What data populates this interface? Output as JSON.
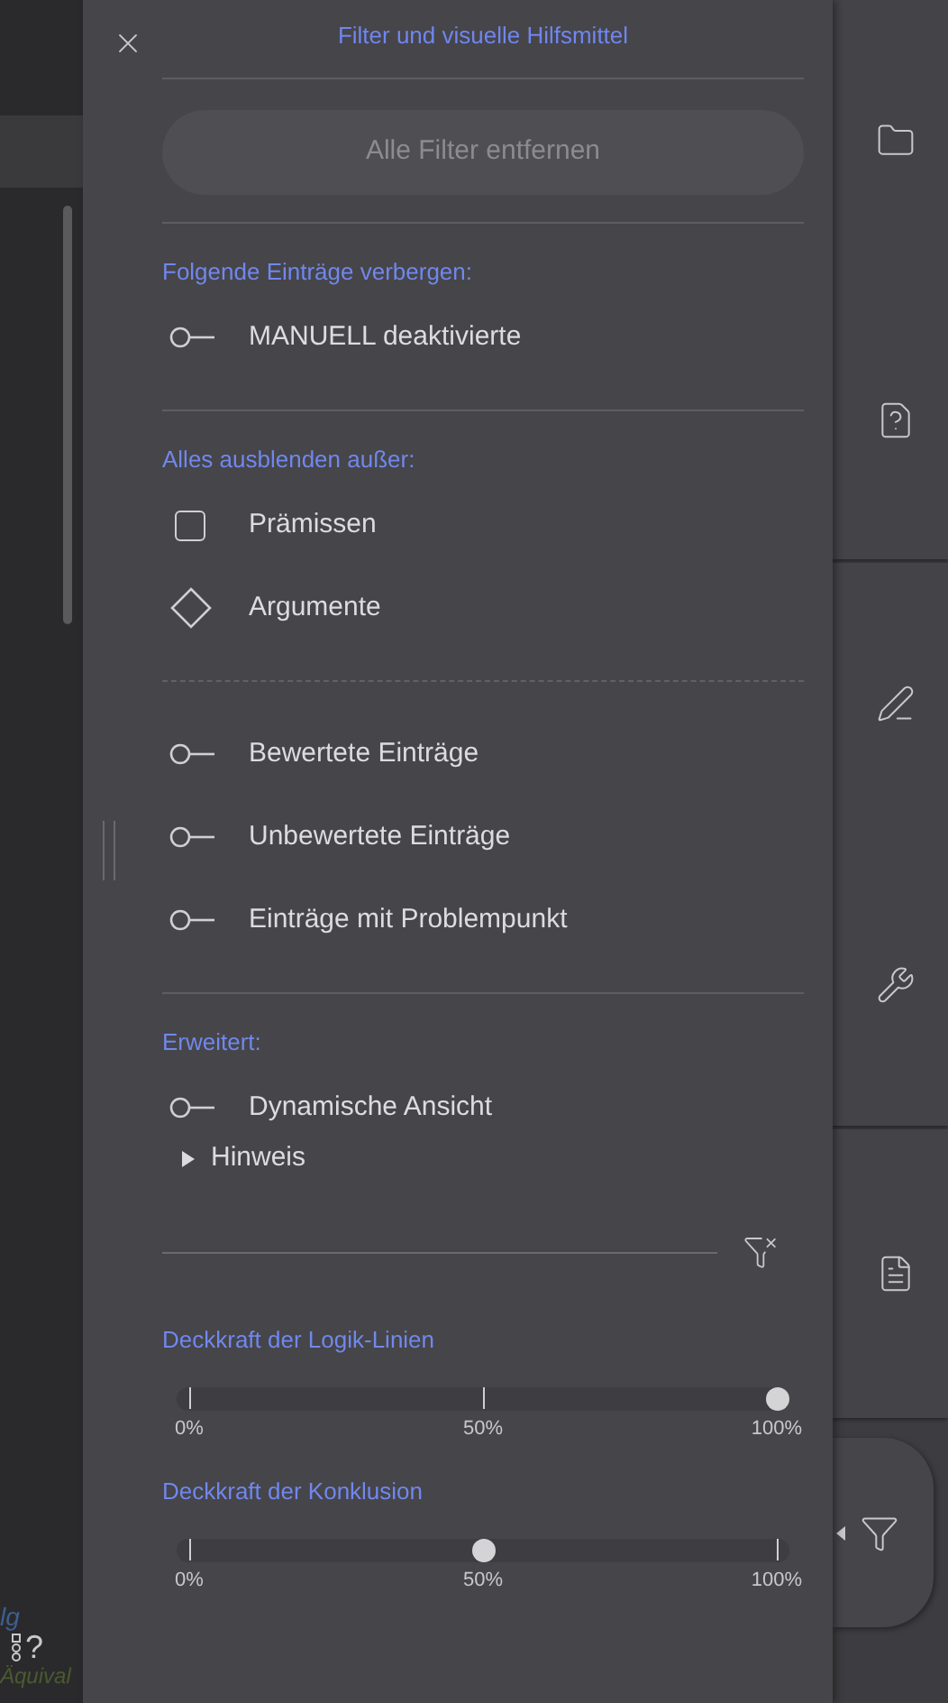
{
  "background": {
    "label": "lg",
    "help": "?",
    "note": "Äquival"
  },
  "panel": {
    "title": "Filter und visuelle Hilfsmittel",
    "clear_button": "Alle Filter entfernen",
    "sections": [
      {
        "label": "Folgende Einträge verbergen:",
        "groups": [
          [
            {
              "kind": "toggle",
              "label": "MANUELL deaktivierte",
              "on": false
            }
          ]
        ]
      },
      {
        "label": "Alles ausblenden außer:",
        "groups": [
          [
            {
              "kind": "checkbox",
              "label": "Prämissen",
              "checked": false
            },
            {
              "kind": "diamond",
              "label": "Argumente",
              "checked": false
            }
          ],
          [
            {
              "kind": "toggle",
              "label": "Bewertete Einträge",
              "on": false
            },
            {
              "kind": "toggle",
              "label": "Unbewertete Einträge",
              "on": false
            },
            {
              "kind": "toggle",
              "label": "Einträge mit Problempunkt",
              "on": false
            }
          ]
        ]
      },
      {
        "label": "Erweitert:",
        "groups": [
          [
            {
              "kind": "toggle",
              "label": "Dynamische Ansicht",
              "on": false
            }
          ]
        ],
        "hint": {
          "label": "Hinweis",
          "expanded": false
        }
      }
    ],
    "sliders": [
      {
        "label": "Deckkraft der Logik-Linien",
        "level": 1,
        "ticks": [
          "0%",
          "50%",
          "100%"
        ]
      },
      {
        "label": "Deckkraft der Konklusion",
        "level": 0.5,
        "ticks": [
          "0%",
          "50%",
          "100%"
        ]
      }
    ]
  }
}
